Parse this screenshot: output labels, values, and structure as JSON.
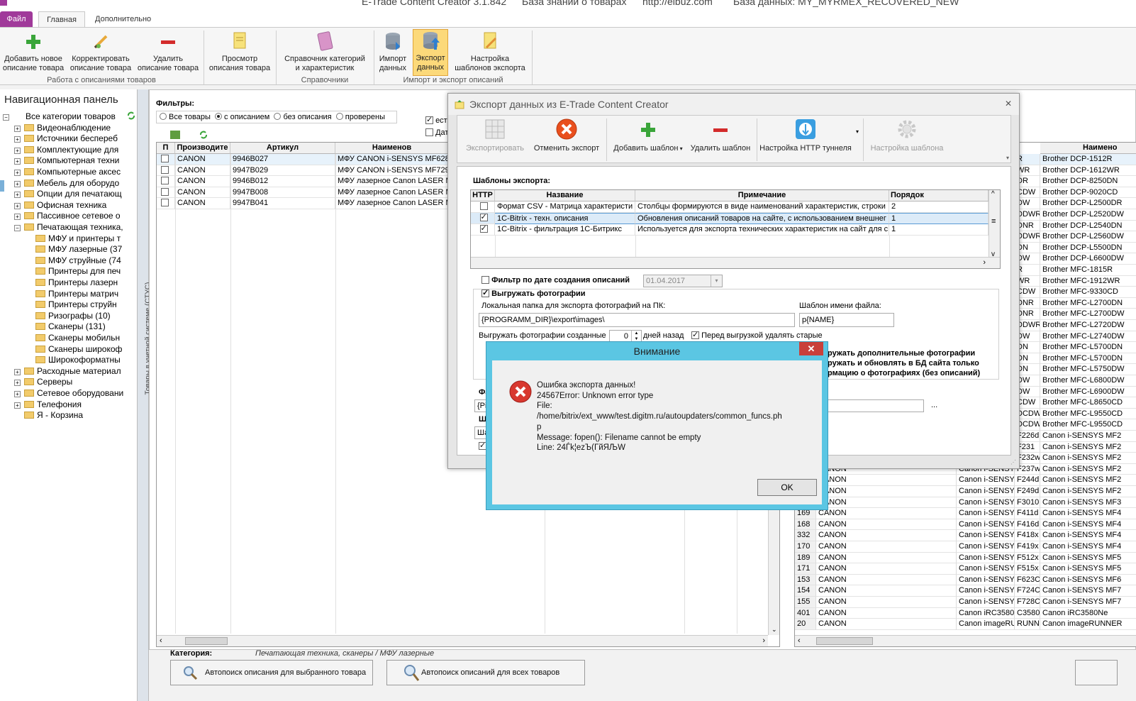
{
  "app": {
    "title": "E-Trade Content Creator 3.1.842",
    "kb": "База знаний о товарах",
    "url": "http://elbuz.com",
    "db": "База данных: MY_MYRMEX_RECOVERED_NEW"
  },
  "tabs": {
    "file": "Файл",
    "main": "Главная",
    "extra": "Дополнительно"
  },
  "ribbon": {
    "add": "Добавить новое\nописание товара",
    "edit": "Корректировать\nописание товара",
    "delete": "Удалить\nописание товара",
    "view": "Просмотр\nописания товара",
    "catalog": "Справочник категорий\nи характеристик",
    "import": "Импорт\nданных",
    "export": "Экспорт\nданных",
    "templates": "Настройка\nшаблонов экспорта",
    "group1": "Работа с описаниями товаров",
    "group2": "Справочники",
    "group3": "Импорт и экспорт описаний"
  },
  "nav": {
    "title": "Навигационная панель",
    "items": [
      {
        "label": "Все категории товаров",
        "level": 0,
        "pm": "−"
      },
      {
        "label": "Видеонаблюдение",
        "level": 1,
        "pm": "+"
      },
      {
        "label": "Источники беспереб",
        "level": 1,
        "pm": "+"
      },
      {
        "label": "Комплектующие для",
        "level": 1,
        "pm": "+"
      },
      {
        "label": "Компьютерная техни",
        "level": 1,
        "pm": "+"
      },
      {
        "label": "Компьютерные аксес",
        "level": 1,
        "pm": "+"
      },
      {
        "label": "Мебель для оборудо",
        "level": 1,
        "pm": "+"
      },
      {
        "label": "Опции для печатающ",
        "level": 1,
        "pm": "+"
      },
      {
        "label": "Офисная техника",
        "level": 1,
        "pm": "+"
      },
      {
        "label": "Пассивное сетевое о",
        "level": 1,
        "pm": "+"
      },
      {
        "label": "Печатающая техника,",
        "level": 1,
        "pm": "−"
      },
      {
        "label": "МФУ и принтеры т",
        "level": 2,
        "pm": ""
      },
      {
        "label": "МФУ лазерные (37",
        "level": 2,
        "pm": ""
      },
      {
        "label": "МФУ струйные (74",
        "level": 2,
        "pm": ""
      },
      {
        "label": "Принтеры для печ",
        "level": 2,
        "pm": ""
      },
      {
        "label": "Принтеры лазерн",
        "level": 2,
        "pm": ""
      },
      {
        "label": "Принтеры матрич",
        "level": 2,
        "pm": ""
      },
      {
        "label": "Принтеры струйн",
        "level": 2,
        "pm": ""
      },
      {
        "label": "Ризографы (10)",
        "level": 2,
        "pm": ""
      },
      {
        "label": "Сканеры (131)",
        "level": 2,
        "pm": ""
      },
      {
        "label": "Сканеры мобильн",
        "level": 2,
        "pm": ""
      },
      {
        "label": "Сканеры широкоф",
        "level": 2,
        "pm": ""
      },
      {
        "label": "Широкоформатны",
        "level": 2,
        "pm": ""
      },
      {
        "label": "Расходные материал",
        "level": 1,
        "pm": "+"
      },
      {
        "label": "Серверы",
        "level": 1,
        "pm": "+"
      },
      {
        "label": "Сетевое оборудовани",
        "level": 1,
        "pm": "+"
      },
      {
        "label": "Телефония",
        "level": 1,
        "pm": "+"
      },
      {
        "label": "Я - Корзина",
        "level": 1,
        "pm": ""
      }
    ]
  },
  "vstrip": "Товары в учетной системе (СТУС)",
  "filters": {
    "label": "Фильтры:",
    "all": "Все товары",
    "with": "с описанием",
    "without": "без описания",
    "checked": "проверены",
    "right1": "ест",
    "right2": "Дат"
  },
  "left_grid": {
    "headers": [
      "П",
      "Производите",
      "Артикул",
      "Наименов"
    ],
    "rows": [
      [
        "CANON",
        "9946B027",
        "МФУ CANON i-SENSYS MF628CW"
      ],
      [
        "CANON",
        "9947B029",
        "МФУ CANON i-SENSYS MF729Cx"
      ],
      [
        "CANON",
        "9946B012",
        "МФУ лазерное Canon LASER MF"
      ],
      [
        "CANON",
        "9947B008",
        "МФУ лазерное Canon LASER MF"
      ],
      [
        "CANON",
        "9947B041",
        "МФУ лазерное Canon LASER MF"
      ]
    ]
  },
  "category": {
    "label": "Категория:",
    "value": "Печатающая техника, сканеры / МФУ лазерные"
  },
  "bottom": {
    "btn1": "Автопоиск описания для выбранного товара",
    "btn2": "Автопоиск описаний для всех товаров"
  },
  "right_grid": {
    "header": "Наимено",
    "col1": [
      "R",
      "WR",
      "DR",
      "CDW",
      "DW",
      "DDWR",
      "DNR",
      "DDWR",
      "DN",
      "DW",
      "R",
      "WR",
      "CDW",
      "DNR",
      "DNR",
      "DDWR",
      "DW",
      "DN",
      "DN",
      "DN",
      "DW",
      "DW",
      "CDW",
      "DCDW",
      "DCDW",
      "F226d",
      "F231",
      "F232w",
      "F237w",
      "F244d",
      "F249d",
      "F3010",
      "F411d",
      "F416d",
      "F418x",
      "F419x",
      "F512x",
      "F515x",
      "F623C",
      "F724C",
      "F728C",
      "C3580Ne",
      "RUNNER 14"
    ],
    "col2": [
      "Brother DCP-1512R",
      "Brother DCP-1612WR",
      "Brother DCP-8250DN",
      "Brother DCP-9020CD",
      "Brother DCP-L2500DR",
      "Brother DCP-L2520DW",
      "Brother DCP-L2540DN",
      "Brother DCP-L2560DW",
      "Brother DCP-L5500DN",
      "Brother DCP-L6600DW",
      "Brother MFC-1815R",
      "Brother MFC-1912WR",
      "Brother MFC-9330CD",
      "Brother MFC-L2700DN",
      "Brother MFC-L2700DW",
      "Brother MFC-L2720DW",
      "Brother MFC-L2740DW",
      "Brother MFC-L5700DN",
      "Brother MFC-L5700DN",
      "Brother MFC-L5750DW",
      "Brother MFC-L6800DW",
      "Brother MFC-L6900DW",
      "Brother MFC-L8650CD",
      "Brother MFC-L9550CD",
      "Brother MFC-L9550CD",
      "Canon i-SENSYS MF2",
      "Canon i-SENSYS MF2",
      "Canon i-SENSYS MF2",
      "Canon i-SENSYS MF2",
      "Canon i-SENSYS MF2",
      "Canon i-SENSYS MF2",
      "Canon i-SENSYS MF3",
      "Canon i-SENSYS MF4",
      "Canon i-SENSYS MF4",
      "Canon i-SENSYS MF4",
      "Canon i-SENSYS MF4",
      "Canon i-SENSYS MF5",
      "Canon i-SENSYS MF5",
      "Canon i-SENSYS MF6",
      "Canon i-SENSYS MF7",
      "Canon i-SENSYS MF7",
      "Canon iRC3580Ne",
      "Canon imageRUNNER"
    ],
    "lower": [
      [
        "",
        "CANON",
        "Canon i-SENSYS MF237w"
      ],
      [
        "",
        "CANON",
        "Canon i-SENSYS MF244d"
      ],
      [
        "",
        "CANON",
        "Canon i-SENSYS MF249d"
      ],
      [
        "",
        "CANON",
        "Canon i-SENSYS MF3010"
      ],
      [
        "169",
        "CANON",
        "Canon i-SENSYS MF411d"
      ],
      [
        "168",
        "CANON",
        "Canon i-SENSYS MF416d"
      ],
      [
        "332",
        "CANON",
        "Canon i-SENSYS MF418x"
      ],
      [
        "170",
        "CANON",
        "Canon i-SENSYS MF419x"
      ],
      [
        "189",
        "CANON",
        "Canon i-SENSYS MF512x"
      ],
      [
        "171",
        "CANON",
        "Canon i-SENSYS MF515x"
      ],
      [
        "153",
        "CANON",
        "Canon i-SENSYS MF623C"
      ],
      [
        "154",
        "CANON",
        "Canon i-SENSYS MF724C"
      ],
      [
        "155",
        "CANON",
        "Canon i-SENSYS MF728C"
      ],
      [
        "401",
        "CANON",
        "Canon iRC3580Ne"
      ],
      [
        "20",
        "CANON",
        "Canon imageRUNNER 14"
      ]
    ]
  },
  "export": {
    "title": "Экспорт данных из E-Trade Content Creator",
    "tb_export": "Экспортировать",
    "tb_cancel": "Отменить экспорт",
    "tb_add": "Добавить шаблон",
    "tb_delete": "Удалить шаблон",
    "tb_http": "Настройка HTTP туннеля",
    "tb_settings": "Настройка шаблона",
    "templates_label": "Шаблоны экспорта:",
    "headers": [
      "HTTP",
      "Название",
      "Примечание",
      "Порядок"
    ],
    "rows": [
      {
        "http": false,
        "name": "Формат CSV - Матрица характеристи",
        "note": "Столбцы формируются в виде наименований характеристик, строки",
        "order": "2"
      },
      {
        "http": true,
        "name": "1C-Bitrix - техн. описания",
        "note": "Обновления описаний товаров на сайте, с использованием внешнег",
        "order": "1"
      },
      {
        "http": true,
        "name": "1C-Bitrix - фильтрация 1С-Битрикс",
        "note": "Используется для экспорта технических характеристик на сайт для с",
        "order": "1"
      }
    ],
    "date_filter": "Фильтр по дате создания описаний",
    "date_value": "01.04.2017",
    "photos": "Выгружать фотографии",
    "local_folder_label": "Локальная папка для экспорта фотографий на ПК:",
    "local_folder": "{PROGRAMM_DIR}\\export\\images\\",
    "file_tpl_label": "Шаблон имени файла:",
    "file_tpl": "p{NAME}",
    "created_label": "Выгружать фотографии созданные",
    "created_value": "0",
    "days_ago": "дней назад",
    "delete_old": "Перед выгрузкой удалять старые",
    "extra1": "ружать дополнительные фотографии",
    "extra2": "ружать и обновлять в БД сайта только",
    "extra3": "рмацию о фотографиях (без описаний)",
    "stub_f": "Фа",
    "stub_fr": "{Рі",
    "stub_sh": "Ш",
    "stub_sha": "Ша",
    "dots": "..."
  },
  "dialog": {
    "title": "Внимание",
    "message": "Ошибка экспорта данных!\n24567Error: Unknown error type\nFile:\n/home/bitrix/ext_www/test.digitm.ru/autoupdaters/common_funcs.ph\np\nMessage: fopen(): Filename cannot be empty\nLine: 24Ѓk¦ezЪ(ГйЯЉW",
    "ok": "OK"
  }
}
